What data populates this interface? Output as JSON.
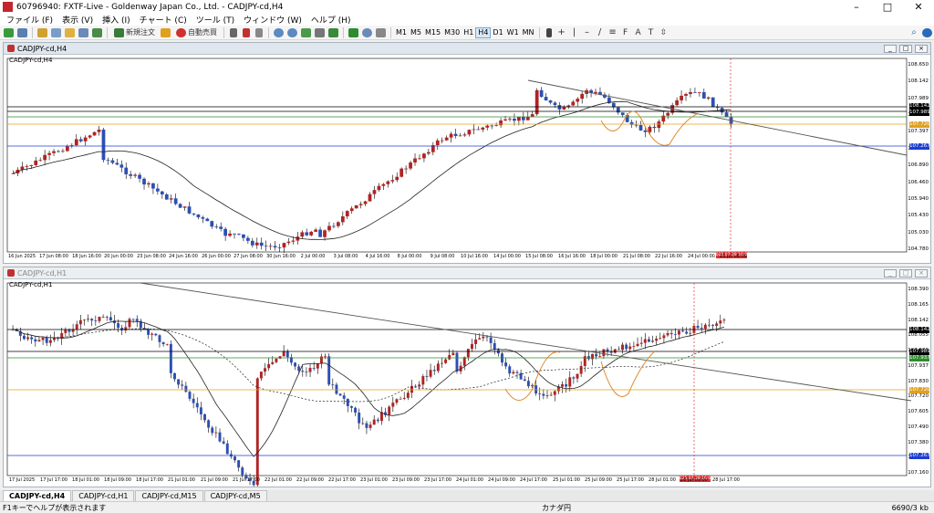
{
  "window": {
    "title": "60796940: FXTF-Live - Goldenway Japan Co., Ltd. - CADJPY-cd,H4",
    "minimize": "–",
    "maximize": "□",
    "close": "✕"
  },
  "menu": [
    "ファイル (F)",
    "表示 (V)",
    "挿入 (I)",
    "チャート (C)",
    "ツール (T)",
    "ウィンドウ (W)",
    "ヘルプ (H)"
  ],
  "toolbar": {
    "new_order": "新規注文",
    "auto_trade": "自動売買",
    "timeframes": [
      "M1",
      "M5",
      "M15",
      "M30",
      "H1",
      "H4",
      "D1",
      "W1",
      "MN"
    ],
    "active_timeframe": "H4"
  },
  "colors": {
    "bull": "#b22222",
    "bear": "#2c4fb3",
    "buy_line": "#000000",
    "green_line": "#2e8b2e",
    "gold_line": "#e0a020",
    "blue_line": "#1c3fd0",
    "trend": "#555555",
    "ma": "#222222",
    "pattern": "#e08a30",
    "vline": "#e03030"
  },
  "chart_top": {
    "window_title": "CADJPY-cd,H4",
    "tag": "CADJPY-cd,H4",
    "price_scale": [
      "108.650",
      "108.142",
      "107.989",
      "107.720",
      "107.397",
      "107.267",
      "106.890",
      "106.460",
      "105.940",
      "105.430",
      "105.030",
      "104.780"
    ],
    "labels": [
      {
        "text": "108.142",
        "kind": "current"
      },
      {
        "text": "107.989",
        "kind": "black"
      },
      {
        "text": "107.720",
        "kind": "gold"
      },
      {
        "text": "107.267",
        "kind": "blue"
      }
    ],
    "time_scale": [
      "16 Jun 2025",
      "17 Jun 08:00",
      "18 Jun 16:00",
      "20 Jun 00:00",
      "23 Jun 08:00",
      "24 Jun 16:00",
      "26 Jun 00:00",
      "27 Jun 08:00",
      "30 Jun 16:00",
      "2 Jul 00:00",
      "3 Jul 08:00",
      "4 Jul 16:00",
      "8 Jul 00:00",
      "9 Jul 08:00",
      "10 Jul 16:00",
      "14 Jul 00:00",
      "15 Jul 08:00",
      "16 Jul 16:00",
      "18 Jul 00:00",
      "21 Jul 08:00",
      "22 Jul 16:00",
      "24 Jul 00:00",
      "25 Jul 08:00"
    ],
    "cursor_time": "2025.07.28 16:00"
  },
  "chart_bottom": {
    "window_title": "CADJPY-cd,H1",
    "tag": "CADJPY-cd,H1",
    "price_scale": [
      "108.390",
      "108.165",
      "108.142",
      "108.055",
      "107.989",
      "107.937",
      "107.830",
      "107.720",
      "107.605",
      "107.490",
      "107.380",
      "107.267",
      "107.160"
    ],
    "labels": [
      {
        "text": "108.142",
        "kind": "current"
      },
      {
        "text": "107.989",
        "kind": "black"
      },
      {
        "text": "107.937",
        "kind": "green"
      },
      {
        "text": "107.720",
        "kind": "gold"
      },
      {
        "text": "107.267",
        "kind": "blue"
      }
    ],
    "time_scale": [
      "17 Jul 2025",
      "17 Jul 17:00",
      "18 Jul 01:00",
      "18 Jul 09:00",
      "18 Jul 17:00",
      "21 Jul 01:00",
      "21 Jul 09:00",
      "21 Jul 17:00",
      "22 Jul 01:00",
      "22 Jul 09:00",
      "22 Jul 17:00",
      "23 Jul 01:00",
      "23 Jul 09:00",
      "23 Jul 17:00",
      "24 Jul 01:00",
      "24 Jul 09:00",
      "24 Jul 17:00",
      "25 Jul 01:00",
      "25 Jul 09:00",
      "25 Jul 17:00",
      "28 Jul 01:00",
      "28 Jul 09:00",
      "28 Jul 17:00"
    ],
    "cursor_time": "2025.07.28 16:00"
  },
  "tabs": [
    {
      "label": "CADJPY-cd,H4",
      "active": true
    },
    {
      "label": "CADJPY-cd,H1",
      "active": false
    },
    {
      "label": "CADJPY-cd,M15",
      "active": false
    },
    {
      "label": "CADJPY-cd,M5",
      "active": false
    }
  ],
  "status": {
    "help": "F1キーでヘルプが表示されます",
    "profile": "カナダ円",
    "traffic": "6690/3 kb"
  }
}
